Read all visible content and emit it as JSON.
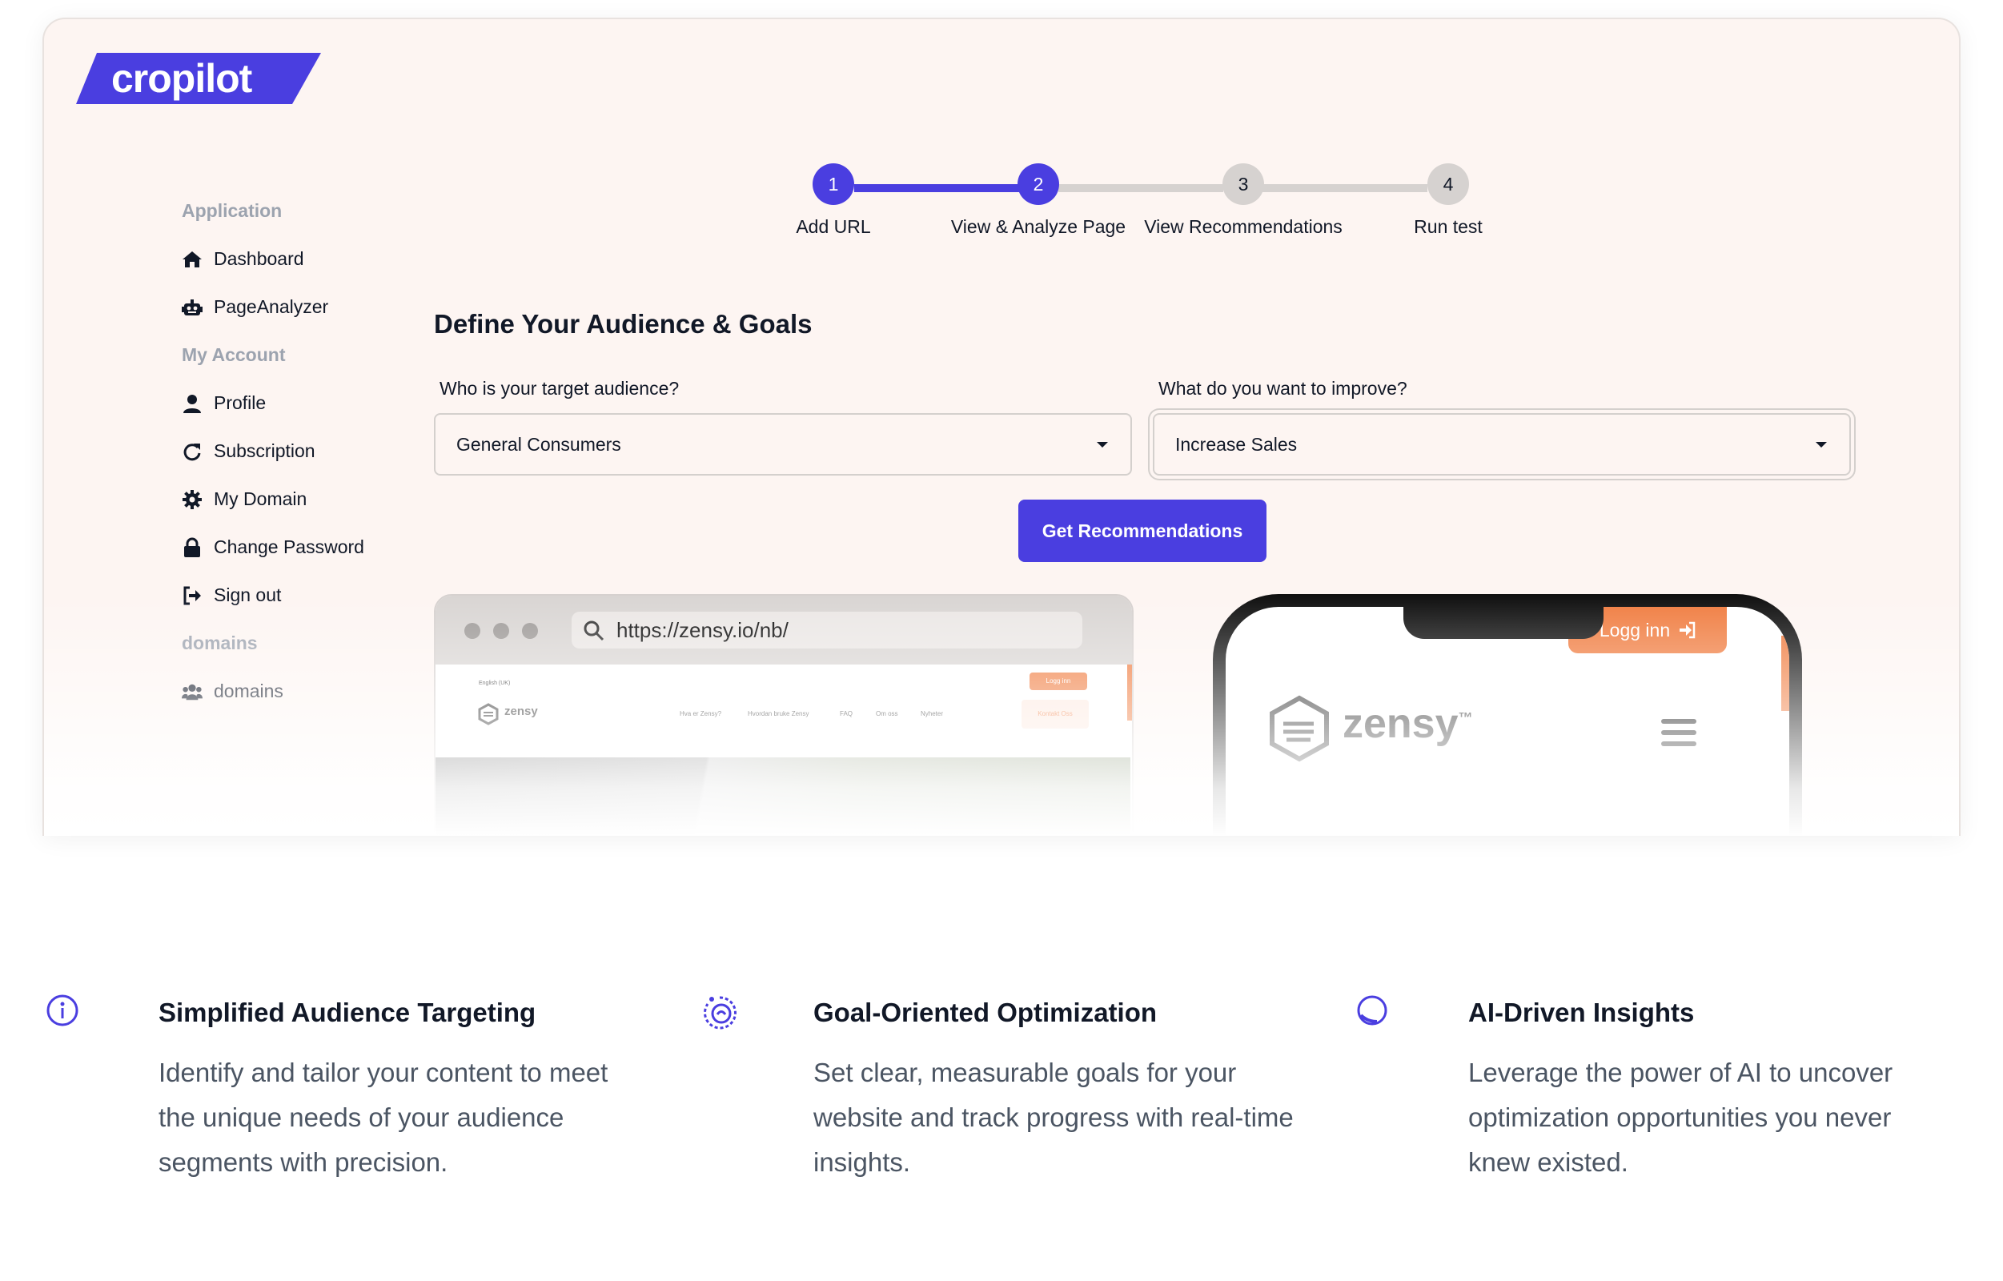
{
  "brand": {
    "logo_text": "cropilot",
    "accent": "#4a3ee0"
  },
  "sidebar": {
    "sections": [
      {
        "title": "Application",
        "items": [
          {
            "label": "Dashboard",
            "icon": "home-icon"
          },
          {
            "label": "PageAnalyzer",
            "icon": "robot-icon"
          }
        ]
      },
      {
        "title": "My Account",
        "items": [
          {
            "label": "Profile",
            "icon": "user-icon"
          },
          {
            "label": "Subscription",
            "icon": "refresh-icon"
          },
          {
            "label": "My Domain",
            "icon": "gear-icon"
          },
          {
            "label": "Change Password",
            "icon": "lock-icon"
          },
          {
            "label": "Sign out",
            "icon": "sign-out-icon"
          }
        ]
      },
      {
        "title": "domains",
        "items": [
          {
            "label": "domains",
            "icon": "users-icon"
          }
        ]
      }
    ]
  },
  "stepper": {
    "current_step": 2,
    "steps": [
      {
        "number": "1",
        "label": "Add URL"
      },
      {
        "number": "2",
        "label": "View & Analyze Page"
      },
      {
        "number": "3",
        "label": "View Recommendations"
      },
      {
        "number": "4",
        "label": "Run test"
      }
    ]
  },
  "form": {
    "heading": "Define Your Audience & Goals",
    "audience": {
      "label": "Who is your target audience?",
      "value": "General Consumers"
    },
    "goal": {
      "label": "What do you want to improve?",
      "value": "Increase Sales"
    },
    "submit_label": "Get Recommendations"
  },
  "preview": {
    "url": "https://zensy.io/nb/",
    "desktop": {
      "language": "English (UK)",
      "brand": "zensy",
      "nav": [
        "Hva er Zensy?",
        "Hvordan bruke Zensy",
        "FAQ",
        "Om oss",
        "Nyheter"
      ],
      "login_label": "Logg inn",
      "contact_label": "Kontakt Oss"
    },
    "mobile": {
      "brand": "zensy",
      "login_label": "Logg inn"
    }
  },
  "features": [
    {
      "icon": "info-circle-icon",
      "title": "Simplified Audience Targeting",
      "description": "Identify and tailor your content to meet the unique needs of your audience segments with precision."
    },
    {
      "icon": "target-swirl-icon",
      "title": "Goal-Oriented Optimization",
      "description": "Set clear, measurable goals for your website and track progress with real-time insights."
    },
    {
      "icon": "ai-circle-icon",
      "title": "AI-Driven Insights",
      "description": "Leverage the power of AI to uncover optimization opportunities you never knew existed."
    }
  ]
}
